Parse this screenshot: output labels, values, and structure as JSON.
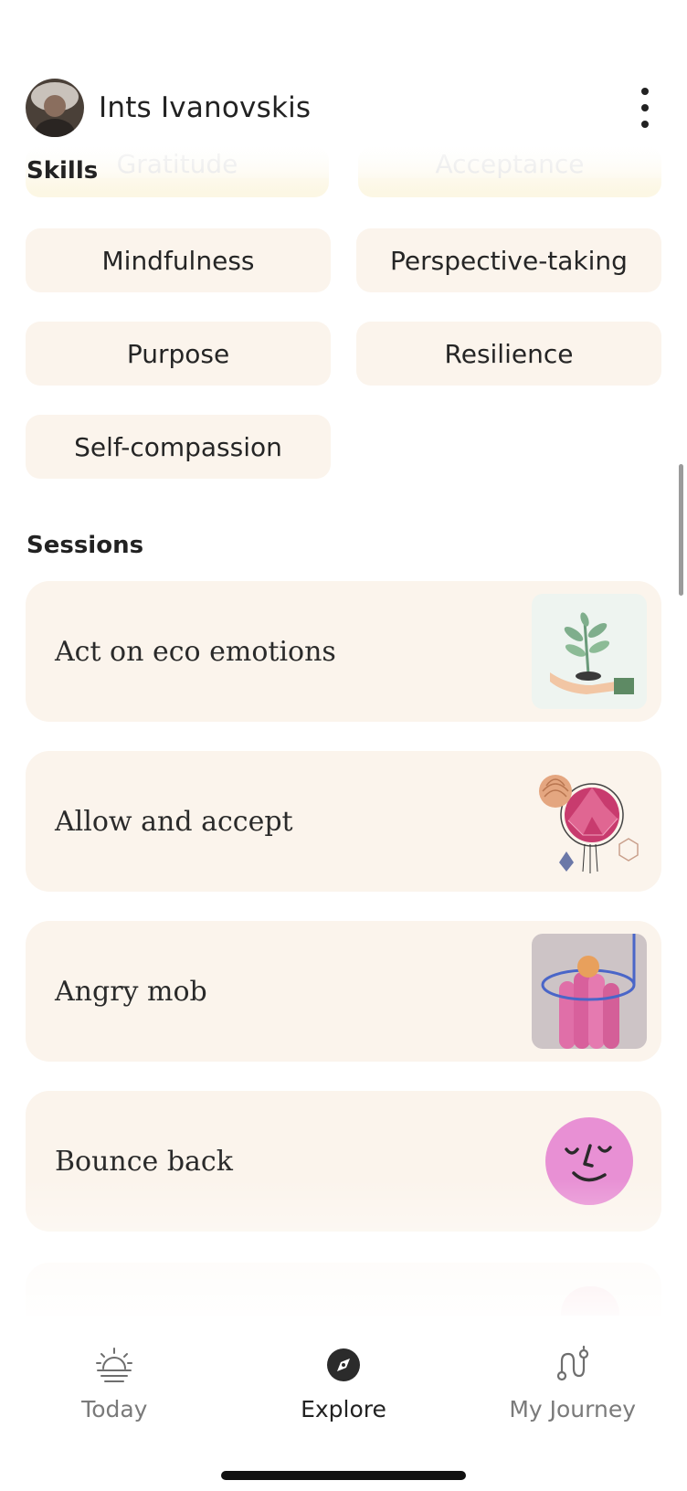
{
  "header": {
    "user_name": "Ints Ivanovskis"
  },
  "skills": {
    "title": "Skills",
    "faded_items": [
      "Gratitude",
      "Acceptance"
    ],
    "items": [
      "Mindfulness",
      "Perspective-taking",
      "Purpose",
      "Resilience",
      "Self-compassion"
    ]
  },
  "sessions": {
    "title": "Sessions",
    "items": [
      {
        "title": "Act on eco emotions",
        "image": "plant-in-hand-illustration"
      },
      {
        "title": "Allow and accept",
        "image": "geometric-pink-sphere-illustration"
      },
      {
        "title": "Angry mob",
        "image": "pink-cylinders-ball-illustration"
      },
      {
        "title": "Bounce back",
        "image": "pink-smiling-face-illustration"
      }
    ]
  },
  "nav": {
    "items": [
      {
        "label": "Today",
        "icon": "sunrise-icon",
        "active": false
      },
      {
        "label": "Explore",
        "icon": "compass-icon",
        "active": true
      },
      {
        "label": "My Journey",
        "icon": "journey-path-icon",
        "active": false
      }
    ]
  },
  "colors": {
    "card_background": "#fbf4ec",
    "accent_pink": "#e890d4",
    "text": "#222222"
  }
}
